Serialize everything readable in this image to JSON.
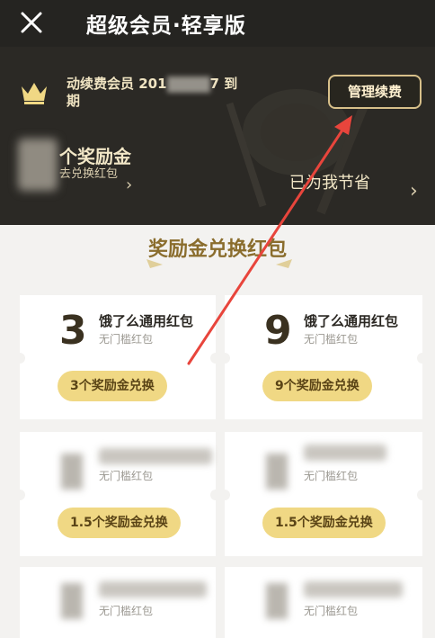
{
  "topbar": {
    "title": "超级会员·轻享版"
  },
  "hero": {
    "member_text": "动续费会员 201",
    "member_text_end": "7 到",
    "member_text_line2": "期",
    "manage_label": "管理续费",
    "reward_title": "个奖励金",
    "reward_sub": "去兑换红包",
    "saved_label": "已为我节省"
  },
  "section": {
    "title": "奖励金兑换红包"
  },
  "coupons": [
    {
      "amount": "3",
      "name": "饿了么通用红包",
      "sub": "无门槛红包",
      "button": "3个奖励金兑换"
    },
    {
      "amount": "9",
      "name": "饿了么通用红包",
      "sub": "无门槛红包",
      "button": "9个奖励金兑换"
    },
    {
      "amount": "",
      "name": "",
      "sub": "无门槛红包",
      "button": "1.5个奖励金兑换"
    },
    {
      "amount": "",
      "name": "",
      "sub": "无门槛红包",
      "button": "1.5个奖励金兑换"
    },
    {
      "amount": "",
      "name": "",
      "sub": "无门槛红包",
      "button": ""
    },
    {
      "amount": "",
      "name": "",
      "sub": "无门槛红包",
      "button": ""
    }
  ],
  "colors": {
    "accent": "#f0d884",
    "dark": "#2b2925",
    "annotation": "#e8453c"
  },
  "icons": {
    "close": "close-icon",
    "crown": "crown-icon",
    "chevron": "chevron-right-icon"
  }
}
